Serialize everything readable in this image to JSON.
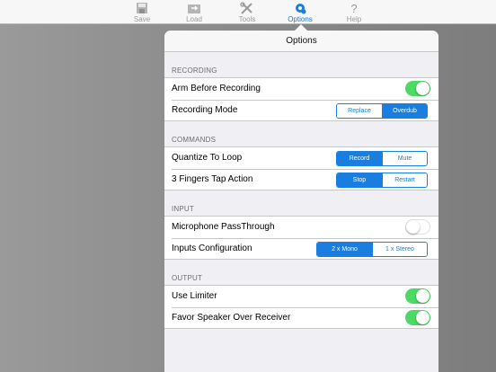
{
  "toolbar": {
    "items": [
      {
        "label": "Save",
        "icon": "save-icon",
        "active": false
      },
      {
        "label": "Load",
        "icon": "load-icon",
        "active": false
      },
      {
        "label": "Tools",
        "icon": "tools-icon",
        "active": false
      },
      {
        "label": "Options",
        "icon": "gear-icon",
        "active": true
      },
      {
        "label": "Help",
        "icon": "help-icon",
        "active": false
      }
    ]
  },
  "options": {
    "title": "Options",
    "sections": [
      {
        "title": "RECORDING",
        "rows": [
          {
            "label": "Arm Before Recording",
            "control": "toggle",
            "on": true
          },
          {
            "label": "Recording Mode",
            "control": "segmented",
            "options": [
              "Replace",
              "Overdub"
            ],
            "selected": 1
          }
        ]
      },
      {
        "title": "COMMANDS",
        "rows": [
          {
            "label": "Quantize To Loop",
            "control": "segmented",
            "options": [
              "Record",
              "Mute"
            ],
            "selected": 0
          },
          {
            "label": "3 Fingers Tap Action",
            "control": "segmented",
            "options": [
              "Stop",
              "Restart"
            ],
            "selected": 0
          }
        ]
      },
      {
        "title": "INPUT",
        "rows": [
          {
            "label": "Microphone PassThrough",
            "control": "toggle",
            "on": false
          },
          {
            "label": "Inputs Configuration",
            "control": "segmented",
            "options": [
              "2 x Mono",
              "1 x Stereo"
            ],
            "selected": 0
          }
        ]
      },
      {
        "title": "OUTPUT",
        "rows": [
          {
            "label": "Use Limiter",
            "control": "toggle",
            "on": true
          },
          {
            "label": "Favor Speaker Over Receiver",
            "control": "toggle",
            "on": true
          }
        ]
      }
    ]
  },
  "colors": {
    "accent": "#1a7de0",
    "toggle_on": "#4cd964"
  }
}
